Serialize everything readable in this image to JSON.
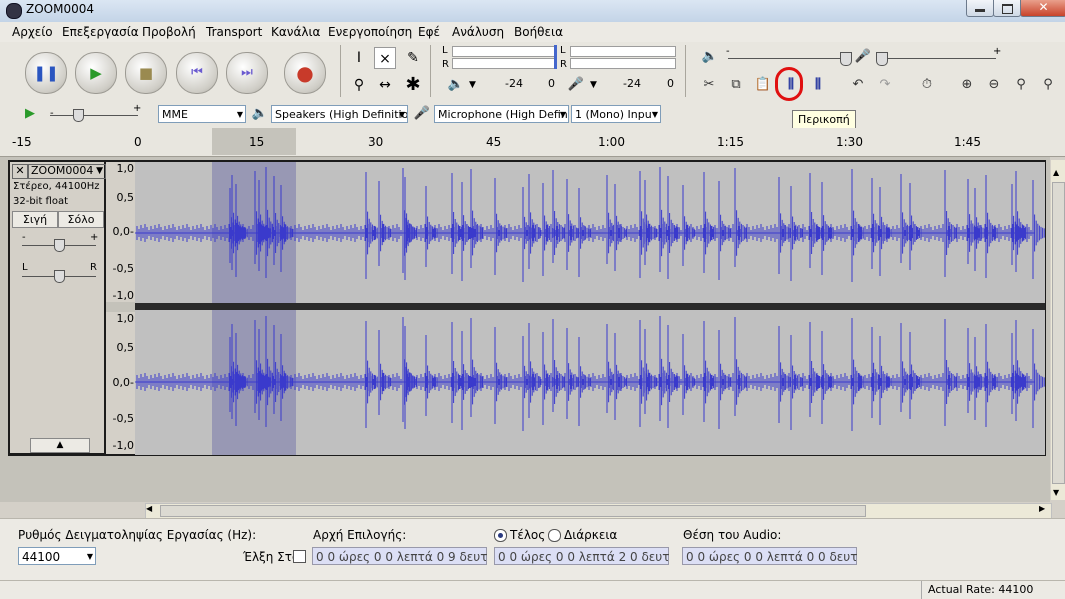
{
  "window": {
    "title": "ZOOM0004"
  },
  "menu": [
    "Αρχείο",
    "Επεξεργασία",
    "Προβολή",
    "Transport",
    "Κανάλια",
    "Ενεργοποίηση",
    "Εφέ",
    "Ανάλυση",
    "Βοήθεια"
  ],
  "meters": {
    "rec_ticks": [
      "-24",
      "0"
    ],
    "play_ticks": [
      "-24",
      "0"
    ],
    "left": "L",
    "right": "R"
  },
  "device": {
    "host": "MME",
    "output": "Speakers (High Definitio",
    "input": "Microphone (High Defini",
    "channels": "1 (Mono) Inpu"
  },
  "tooltip": "Περικοπή",
  "ruler": [
    "-15",
    "0",
    "15",
    "30",
    "45",
    "1:00",
    "1:15",
    "1:30",
    "1:45"
  ],
  "track": {
    "name": "ZOOM0004",
    "info1": "Στέρεο, 44100Hz",
    "info2": "32-bit float",
    "mute": "Σιγή",
    "solo": "Σόλο",
    "gain_minus": "-",
    "gain_plus": "+",
    "pan_left": "L",
    "pan_right": "R",
    "scale": [
      "1,0",
      "0,5",
      "0,0-",
      "-0,5",
      "-1,0"
    ]
  },
  "bottom": {
    "rate_label": "Ρυθμός Δειγματοληψίας Εργασίας (Hz):",
    "rate_value": "44100",
    "snap_label": "Έλξη Στο",
    "start_label": "Αρχή Επιλογής:",
    "end_label": "Τέλος",
    "length_label": "Διάρκεια",
    "position_label": "Θέση του Audio:",
    "start_time": "0 0 ώρες 0 0 λεπτά 0 9 δευτ",
    "end_time": "0 0 ώρες 0 0 λεπτά 2 0 δευτ",
    "audio_time": "0 0 ώρες 0 0 λεπτά 0 0 δευτ"
  },
  "status": {
    "actual_rate": "Actual Rate: 44100"
  }
}
